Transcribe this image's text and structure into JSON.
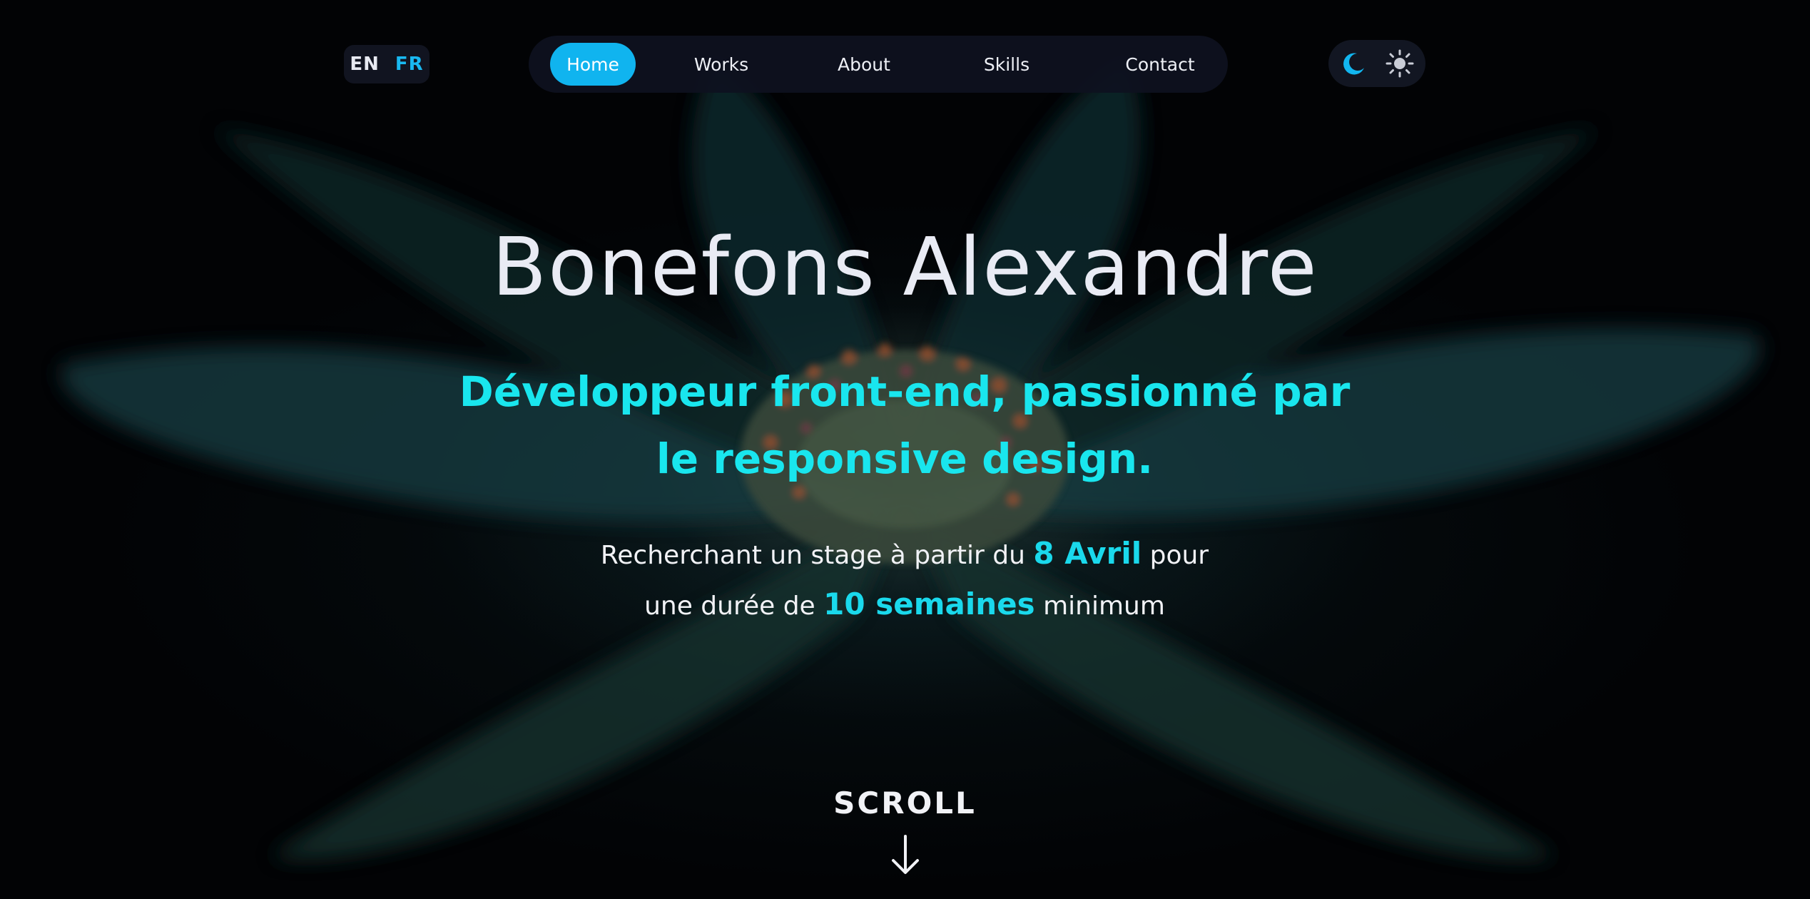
{
  "lang_switch": {
    "en": "EN",
    "fr": "FR",
    "active": "FR"
  },
  "nav": {
    "items": [
      {
        "label": "Home",
        "active": true
      },
      {
        "label": "Works",
        "active": false
      },
      {
        "label": "About",
        "active": false
      },
      {
        "label": "Skills",
        "active": false
      },
      {
        "label": "Contact",
        "active": false
      }
    ]
  },
  "theme_switch": {
    "options": [
      "moon-icon",
      "sun-icon"
    ],
    "active": "moon-icon"
  },
  "hero": {
    "title": "Bonefons Alexandre",
    "subtitle_line1": "Développeur front-end, passionné par",
    "subtitle_line2": "le responsive design.",
    "avail_line1_pre": "Recherchant un stage à partir du",
    "avail_line1_hl": "8 Avril",
    "avail_line1_post": "pour",
    "avail_line2_pre": "une durée de",
    "avail_line2_hl": "10 semaines",
    "avail_line2_post": "minimum"
  },
  "scroll": {
    "label": "SCROLL",
    "icon": "arrow-down-icon"
  },
  "colors": {
    "accent": "#10b4ef",
    "highlight": "#19e6ee",
    "background": "#020305",
    "nav_bg": "#0e1120"
  }
}
